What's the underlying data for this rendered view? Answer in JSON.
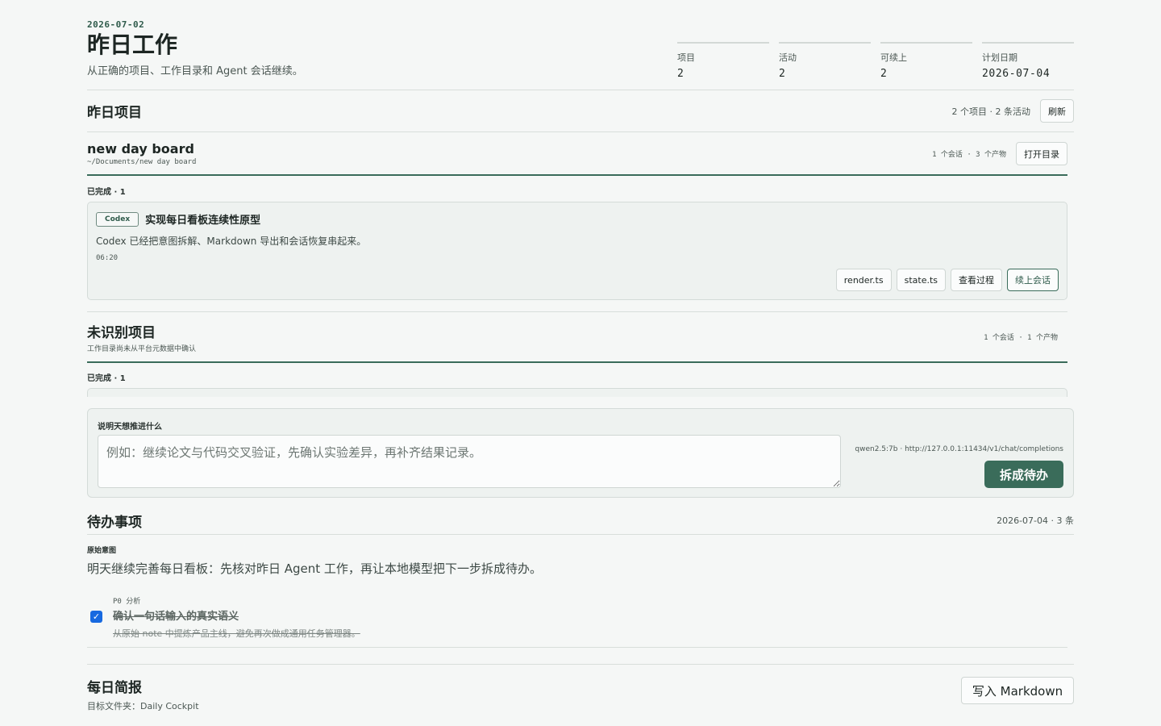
{
  "header": {
    "date": "2026-07-02",
    "title": "昨日工作",
    "subtitle": "从正确的项目、工作目录和 Agent 会话继续。",
    "stats": [
      {
        "label": "项目",
        "value": "2"
      },
      {
        "label": "活动",
        "value": "2"
      },
      {
        "label": "可续上",
        "value": "2"
      },
      {
        "label": "计划日期",
        "value": "2026-07-04"
      }
    ]
  },
  "yesterday": {
    "title": "昨日项目",
    "meta": "2 个项目 · 2 条活动",
    "refresh_label": "刷新"
  },
  "project": {
    "name": "new day board",
    "path": "~/Documents/new day board",
    "meta": "1 个会话 · 3 个产物",
    "open_dir_label": "打开目录",
    "group_label": "已完成 · 1",
    "card": {
      "badge": "Codex",
      "title": "实现每日看板连续性原型",
      "desc": "Codex 已经把意图拆解、Markdown 导出和会话恢复串起来。",
      "time": "06:20",
      "actions": [
        "render.ts",
        "state.ts",
        "查看过程",
        "续上会话"
      ]
    }
  },
  "unknown": {
    "title": "未识别项目",
    "subtitle": "工作目录尚未从平台元数据中确认",
    "meta": "1 个会话 · 1 个产物",
    "group_label": "已完成 · 1"
  },
  "composer": {
    "label": "说明天想推进什么",
    "placeholder": "例如：继续论文与代码交叉验证，先确认实验差异，再补齐结果记录。",
    "model": "qwen2.5:7b · http://127.0.0.1:11434/v1/chat/completions",
    "submit_label": "拆成待办"
  },
  "todos": {
    "title": "待办事项",
    "meta": "2026-07-04 · 3 条",
    "intent_label": "原始意图",
    "intent_text": "明天继续完善每日看板：先核对昨日 Agent 工作，再让本地模型把下一步拆成待办。",
    "items": [
      {
        "meta": "P0  分析",
        "title": "确认一句话输入的真实语义",
        "note": "从原始 note 中提炼产品主线，避免再次做成通用任务管理器。",
        "checked": true
      }
    ]
  },
  "daily": {
    "title": "每日简报",
    "subtitle": "目标文件夹：Daily Cockpit",
    "write_label": "写入 Markdown"
  }
}
